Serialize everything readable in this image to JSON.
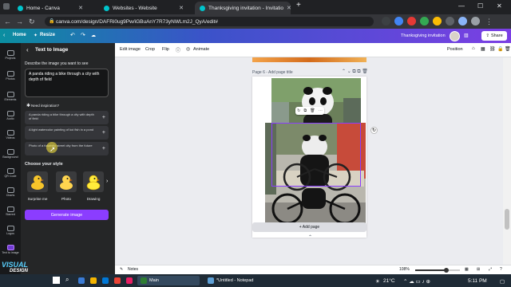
{
  "browser": {
    "tabs": [
      {
        "title": "Home - Canva",
        "color": "#00c4cc",
        "active": false
      },
      {
        "title": "Websites - Website",
        "color": "#00c4cc",
        "active": false
      },
      {
        "title": "Thanksgiving invitation - Invitatio",
        "color": "#00c4cc",
        "active": true
      }
    ],
    "new_tab": "+",
    "url": "canva.com/design/DAFRi0ug9Pw/iGBuAnY7R73yNWLm2J_QyA/edit#",
    "window_controls": {
      "minimize": "—",
      "maximize": "☐",
      "close": "✕"
    }
  },
  "canva_header": {
    "home": "Home",
    "resize": "Resize",
    "design_title": "Thanksgiving invitation",
    "share": "Share",
    "colors": {
      "gradient_start": "#0b8ea0",
      "gradient_end": "#7b3fe4",
      "accent": "#8b3dff"
    }
  },
  "rail": {
    "items": [
      {
        "label": "Projects",
        "icon": "folder-icon"
      },
      {
        "label": "Photos",
        "icon": "photo-icon"
      },
      {
        "label": "Elements",
        "icon": "shapes-icon"
      },
      {
        "label": "Audio",
        "icon": "music-icon"
      },
      {
        "label": "Videos",
        "icon": "video-icon"
      },
      {
        "label": "Background",
        "icon": "background-icon"
      },
      {
        "label": "QR Code",
        "icon": "qr-icon"
      },
      {
        "label": "Charts",
        "icon": "chart-icon"
      },
      {
        "label": "Starred",
        "icon": "star-icon"
      },
      {
        "label": "Logos",
        "icon": "logo-icon"
      },
      {
        "label": "Text to image",
        "icon": "text-to-image-icon",
        "active": true
      }
    ]
  },
  "panel": {
    "title": "Text to Image",
    "describe_label": "Describe the image you want to see",
    "prompt": "A panda riding a bike through a city with depth of field",
    "inspiration_label": "Need inspiration?",
    "suggestions": [
      "A panda riding a bike through a city with depth of field",
      "A light watercolor painting of koi fish in a pond",
      "Photo of a futuristic street city from the future"
    ],
    "style_label": "Choose your style",
    "styles": [
      "Surprise me",
      "Photo",
      "Drawing"
    ],
    "generate": "Generate image"
  },
  "toolbar": {
    "edit_image": "Edit image",
    "crop": "Crop",
    "flip": "Flip",
    "info": "ⓘ",
    "animate": "Animate",
    "position": "Position"
  },
  "canvas": {
    "page_label": "Page 6 - Add page title",
    "add_page": "+ Add page"
  },
  "statusbar": {
    "notes": "Notes",
    "zoom": "108%",
    "zoom_level": 0.7
  },
  "taskbar": {
    "apps": [
      {
        "label": "Main",
        "color": "#2e7d32"
      },
      {
        "label": "*Untitled - Notepad",
        "color": "#5ea0d6"
      }
    ],
    "temperature": "21°C",
    "time": "5:11 PM"
  },
  "watermark": {
    "line1": "VISUAL",
    "line2": "DESIGN"
  }
}
